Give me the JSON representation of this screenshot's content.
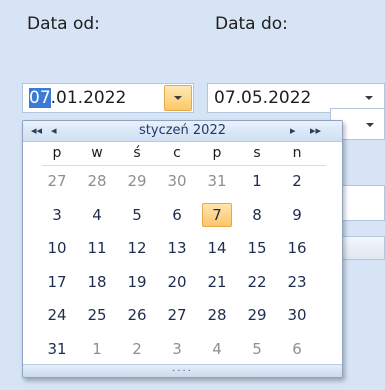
{
  "labels": {
    "from": "Data od:",
    "to": "Data do:"
  },
  "from_field": {
    "selected_part": "07",
    "rest": ".01.2022"
  },
  "to_field": {
    "value": "07.05.2022"
  },
  "calendar": {
    "month_title": "styczeń 2022",
    "nav": {
      "prev_year": "◂◂",
      "prev_month": "◂",
      "next_month": "▸",
      "next_year": "▸▸"
    },
    "weekdays": [
      "p",
      "w",
      "ś",
      "c",
      "p",
      "s",
      "n"
    ],
    "weeks": [
      [
        "27",
        "28",
        "29",
        "30",
        "31",
        "1",
        "2"
      ],
      [
        "3",
        "4",
        "5",
        "6",
        "7",
        "8",
        "9"
      ],
      [
        "10",
        "11",
        "12",
        "13",
        "14",
        "15",
        "16"
      ],
      [
        "17",
        "18",
        "19",
        "20",
        "21",
        "22",
        "23"
      ],
      [
        "24",
        "25",
        "26",
        "27",
        "28",
        "29",
        "30"
      ],
      [
        "31",
        "1",
        "2",
        "3",
        "4",
        "5",
        "6"
      ]
    ],
    "other_month": [
      [
        true,
        true,
        true,
        true,
        true,
        false,
        false
      ],
      [
        false,
        false,
        false,
        false,
        false,
        false,
        false
      ],
      [
        false,
        false,
        false,
        false,
        false,
        false,
        false
      ],
      [
        false,
        false,
        false,
        false,
        false,
        false,
        false
      ],
      [
        false,
        false,
        false,
        false,
        false,
        false,
        false
      ],
      [
        false,
        true,
        true,
        true,
        true,
        true,
        true
      ]
    ],
    "today": {
      "week": 1,
      "day": 4
    },
    "footer_grip": "...."
  },
  "colors": {
    "background": "#d6e4f5",
    "selection": "#3a7bd5",
    "today_highlight": "#fbc66a",
    "day_text": "#1e2d4e",
    "other_month_text": "#8f8f8f"
  }
}
